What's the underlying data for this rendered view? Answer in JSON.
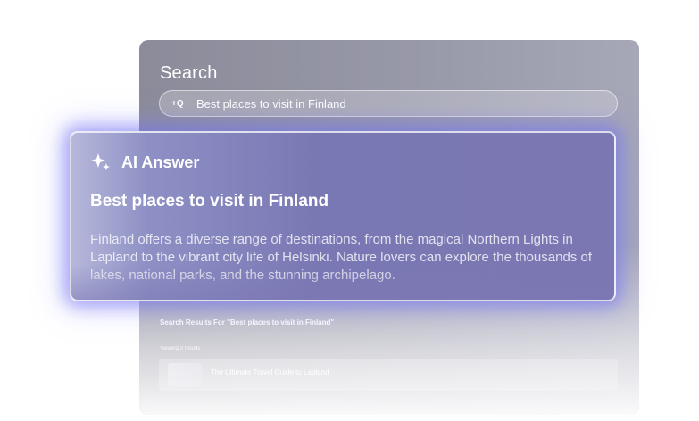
{
  "search_window": {
    "title": "Search",
    "search_icon": "ai-search-icon",
    "search_icon_glyph": "+Q",
    "query": "Best places to visit in Finland",
    "results_heading": "Search Results For \"Best places to visit in Finland\"",
    "results_count": "Viewing 3 results",
    "results": [
      {
        "title": "The Ultimate Travel Guide to Lapland"
      }
    ]
  },
  "ai_answer": {
    "icon": "sparkle-icon",
    "label": "AI Answer",
    "heading": "Best places to visit in Finland",
    "body": "Finland offers a diverse range of destinations, from the magical Northern Lights in Lapland to the vibrant city life of Helsinki. Nature lovers can explore the thousands of lakes, national parks, and the stunning archipelago."
  },
  "colors": {
    "ai_glow": "#6e6ef0",
    "card_purple": "#7b77b2",
    "window_gray": "#9899a8"
  }
}
